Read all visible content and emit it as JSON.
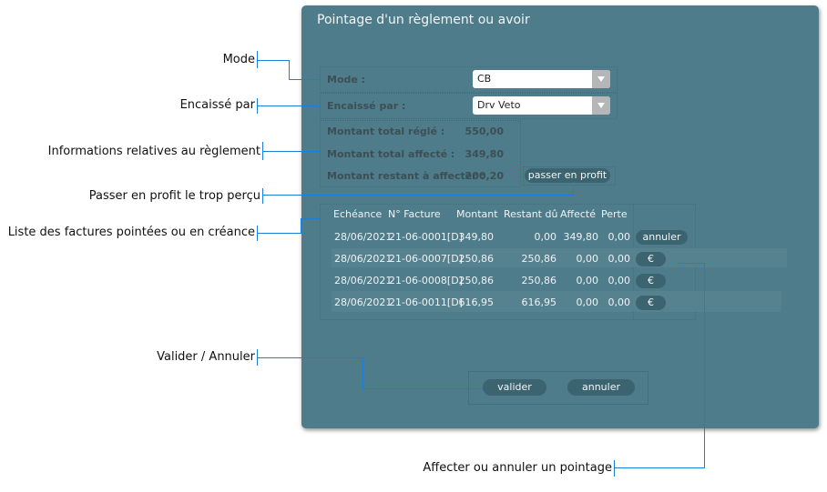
{
  "dialog": {
    "title": "Pointage d'un règlement ou avoir"
  },
  "form": {
    "mode_label": "Mode :",
    "mode_value": "CB",
    "encaisse_label": "Encaissé par :",
    "encaisse_value": "Drv Veto",
    "total_regle_label": "Montant total réglé :",
    "total_regle": "550,00",
    "total_affecte_label": "Montant total affecté :",
    "total_affecte": "349,80",
    "restant_label": "Montant restant à affecter :",
    "restant": "200,20",
    "profit_button": "passer en profit"
  },
  "table": {
    "headers": [
      "Echéance",
      "N° Facture",
      "Montant",
      "Restant dû",
      "Affecté",
      "Perte"
    ],
    "rows": [
      {
        "cells": [
          "28/06/2021",
          "21-06-0001[D]",
          "349,80",
          "0,00",
          "349,80",
          "0,00"
        ],
        "action": "annuler"
      },
      {
        "cells": [
          "28/06/2021",
          "21-06-0007[D]",
          "250,86",
          "250,86",
          "0,00",
          "0,00"
        ],
        "action": "€"
      },
      {
        "cells": [
          "28/06/2021",
          "21-06-0008[D]",
          "250,86",
          "250,86",
          "0,00",
          "0,00"
        ],
        "action": "€"
      },
      {
        "cells": [
          "28/06/2021",
          "21-06-0011[D]",
          "616,95",
          "616,95",
          "0,00",
          "0,00"
        ],
        "action": "€"
      }
    ]
  },
  "footer": {
    "valider": "valider",
    "annuler": "annuler"
  },
  "callouts": {
    "mode": "Mode",
    "encaisse": "Encaissé par",
    "infos": "Informations relatives au règlement",
    "profit": "Passer en profit le trop perçu",
    "liste": "Liste des factures pointées ou en créance",
    "valider": "Valider / Annuler",
    "affecter": "Affecter ou annuler un pointage"
  },
  "colors": {
    "panel": "#4e7c8a",
    "button": "#3c6370",
    "callout_line": "#1a7fd6",
    "highlight": "#e0245e"
  }
}
